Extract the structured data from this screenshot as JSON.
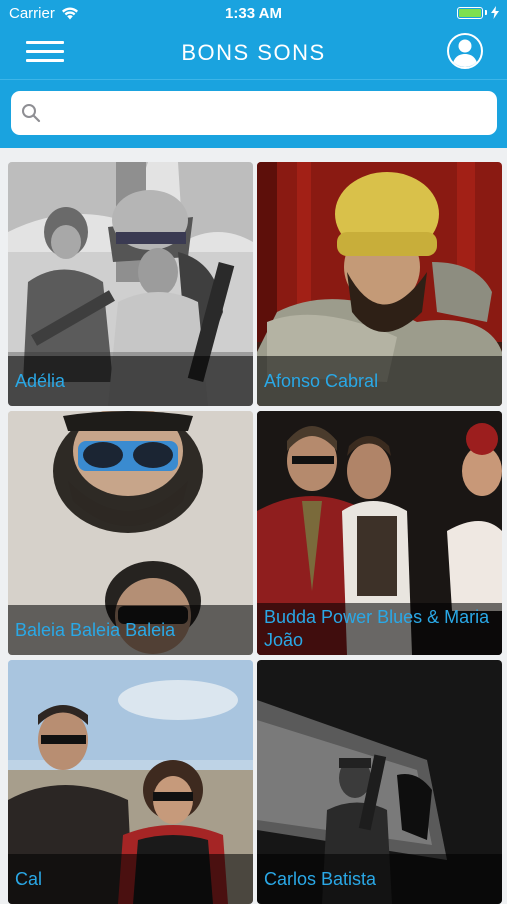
{
  "status": {
    "carrier": "Carrier",
    "time": "1:33 AM"
  },
  "header": {
    "title": "BONS SONS"
  },
  "search": {
    "placeholder": "",
    "value": ""
  },
  "artists": [
    {
      "name": "Adélia"
    },
    {
      "name": "Afonso Cabral"
    },
    {
      "name": "Baleia Baleia Baleia"
    },
    {
      "name": "Budda Power Blues & Maria João"
    },
    {
      "name": "Cal"
    },
    {
      "name": "Carlos Batista"
    }
  ],
  "colors": {
    "accent": "#1aa3df",
    "caption_text": "#2aa8e6",
    "battery": "#7ee04f"
  }
}
